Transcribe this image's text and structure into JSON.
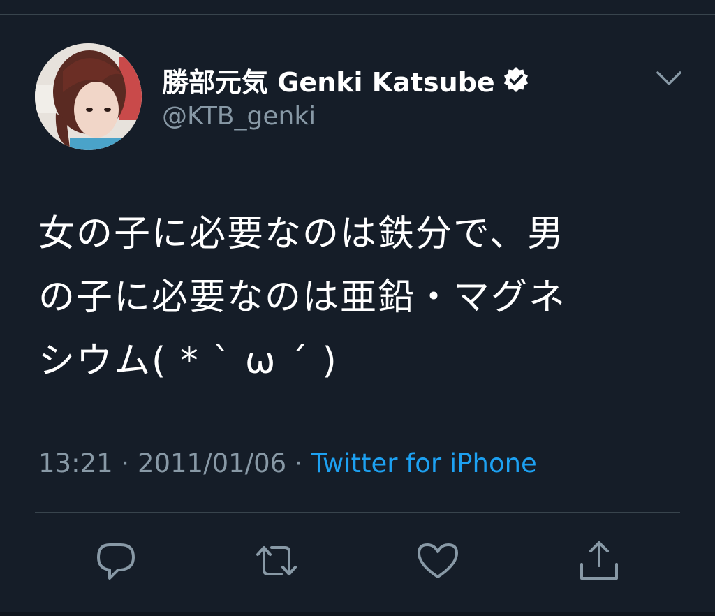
{
  "tweet": {
    "display_name": "勝部元気 Genki Katsube",
    "handle": "@KTB_genki",
    "verified": true,
    "text": "女の子に必要なのは鉄分で、男\nの子に必要なのは亜鉛・マグネ\nシウム( * ˋ ω ˊ )",
    "time": "13:21",
    "date": "2011/01/06",
    "separator": "·",
    "source": "Twitter for iPhone"
  },
  "icons": {
    "more": "chevron-down-icon",
    "verified": "verified-badge-icon",
    "reply": "reply-icon",
    "retweet": "retweet-icon",
    "like": "like-icon",
    "share": "share-icon"
  },
  "colors": {
    "background": "#151d28",
    "text": "#ffffff",
    "secondary": "#8899a6",
    "link": "#1da1f2",
    "divider": "#38444d"
  }
}
